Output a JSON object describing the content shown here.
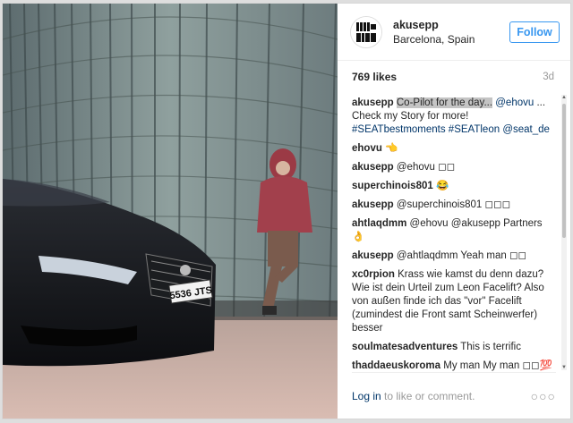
{
  "post": {
    "author": {
      "username": "akusepp",
      "location": "Barcelona, Spain",
      "avatar_text": "AKUSEPP"
    },
    "follow_label": "Follow",
    "likes": "769 likes",
    "time_ago": "3d",
    "license_plate": "5536 JTS",
    "caption": {
      "user": "akusepp",
      "highlight": "Co-Pilot for the day...",
      "mention": "@ehovu",
      "text": "... Check my Story for more!",
      "hashtags": "#SEATbestmoments #SEATleon",
      "mention2": "@seat_de"
    },
    "comments": [
      {
        "user": "ehovu",
        "text": "👈"
      },
      {
        "user": "akusepp",
        "text": "@ehovu ◻◻"
      },
      {
        "user": "superchinois801",
        "text": "😂"
      },
      {
        "user": "akusepp",
        "text": "@superchinois801 ◻◻◻"
      },
      {
        "user": "ahtlaqdmm",
        "text": "@ehovu @akusepp Partners 👌"
      },
      {
        "user": "akusepp",
        "text": "@ahtlaqdmm Yeah man ◻◻"
      },
      {
        "user": "xc0rpion",
        "text": "Krass wie kamst du denn dazu? Wie ist dein Urteil zum Leon Facelift? Also von außen finde ich das \"vor\" Facelift (zumindest die Front samt Scheinwerfer) besser"
      },
      {
        "user": "soulmatesadventures",
        "text": "This is terrific"
      },
      {
        "user": "thaddaeuskoroma",
        "text": "My man My man ◻◻💯 @akusepp"
      }
    ],
    "footer": {
      "login_link": "Log in",
      "login_text": " to like or comment.",
      "more": "○○○"
    }
  }
}
